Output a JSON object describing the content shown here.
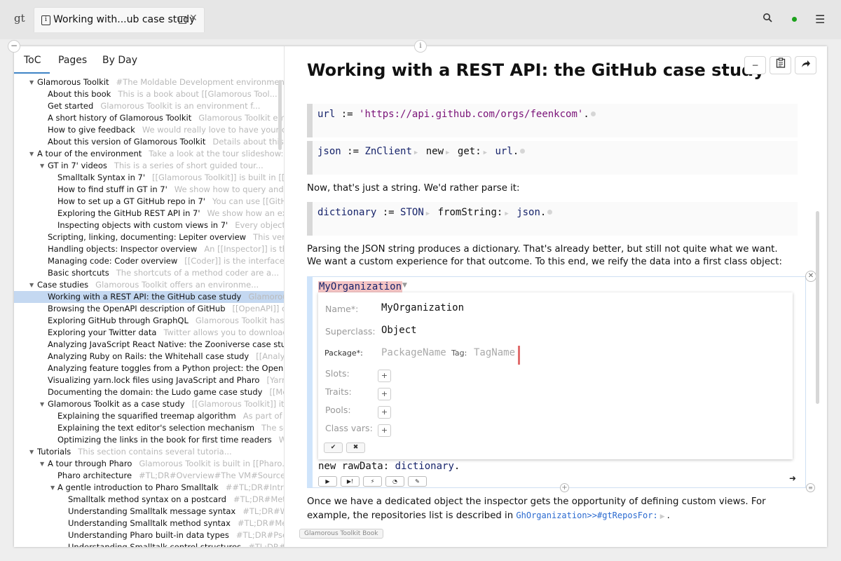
{
  "app": {
    "logo": "gt"
  },
  "tab": {
    "icon": "i",
    "label": "Working with...ub case study"
  },
  "left_tabs": [
    "ToC",
    "Pages",
    "By Day"
  ],
  "toc": [
    {
      "level": 1,
      "expanded": true,
      "title": "Glamorous Toolkit",
      "snippet": "#The Moldable Development environment..."
    },
    {
      "level": 2,
      "title": "About this book",
      "snippet": "This is a book about [[Glamorous Tool..."
    },
    {
      "level": 2,
      "title": "Get started",
      "snippet": "Glamorous Toolkit is an environment f..."
    },
    {
      "level": 2,
      "title": "A short history of Glamorous Toolkit",
      "snippet": "Glamorous Toolkit embodie"
    },
    {
      "level": 2,
      "title": "How to give feedback",
      "snippet": "We would really love to have your con..."
    },
    {
      "level": 2,
      "title": "About this version of Glamorous Toolkit",
      "snippet": "Details about this versio"
    },
    {
      "level": 1,
      "expanded": true,
      "title": "A tour of the environment",
      "snippet": "Take a look at the tour slideshow:GtP..."
    },
    {
      "level": 2,
      "expanded": true,
      "title": "GT in 7' videos",
      "snippet": "This is a series of short guided tour..."
    },
    {
      "level": 3,
      "title": "Smalltalk Syntax in 7'",
      "snippet": "[[Glamorous Toolkit]] is built in [[P..."
    },
    {
      "level": 3,
      "title": "How to find stuff in GT in 7'",
      "snippet": "We show how to query and explore"
    },
    {
      "level": 3,
      "title": "How to set up a GT GitHub repo in 7'",
      "snippet": "You can use [[GitHub]] to"
    },
    {
      "level": 3,
      "title": "Exploring the GitHub REST API in 7'",
      "snippet": "We show how an explorable"
    },
    {
      "level": 3,
      "title": "Inspecting objects with custom views in 7'",
      "snippet": "Every object in [[Glam"
    },
    {
      "level": 2,
      "title": "Scripting, linking, documenting: Lepiter overview",
      "snippet": "This very book i"
    },
    {
      "level": 2,
      "title": "Handling objects: Inspector overview",
      "snippet": "An [[Inspector]] is the most i"
    },
    {
      "level": 2,
      "title": "Managing code: Coder overview",
      "snippet": "[[Coder]] is the interface for mana"
    },
    {
      "level": 2,
      "title": "Basic shortcuts",
      "snippet": "The shortcuts of a method coder are a..."
    },
    {
      "level": 1,
      "expanded": true,
      "title": "Case studies",
      "snippet": "Glamorous Toolkit offers an environme..."
    },
    {
      "level": 2,
      "selected": true,
      "title": "Working with a REST API: the GitHub case study",
      "snippet": "Glamorous Toolk"
    },
    {
      "level": 2,
      "title": "Browsing the OpenAPI description of GitHub",
      "snippet": "[[OpenAPI]] offers a s"
    },
    {
      "level": 2,
      "title": "Exploring GitHub through GraphQL",
      "snippet": "Glamorous Toolkit has built-in"
    },
    {
      "level": 2,
      "title": "Exploring your Twitter data",
      "snippet": "Twitter allows you to download your"
    },
    {
      "level": 2,
      "title": "Analyzing JavaScript React Native: the Zooniverse case study",
      "snippet": "Zoo"
    },
    {
      "level": 2,
      "title": "Analyzing Ruby on Rails: the Whitehall case study",
      "snippet": "[[Analyzing Java"
    },
    {
      "level": 2,
      "title": "Analyzing feature toggles from a Python project: the Open edX case",
      "snippet": ""
    },
    {
      "level": 2,
      "title": "Visualizing yarn.lock files using JavaScript and Pharo",
      "snippet": "[Yarn](https"
    },
    {
      "level": 2,
      "title": "Documenting the domain: the Ludo game case study",
      "snippet": "[[Moldable D"
    },
    {
      "level": 2,
      "expanded": true,
      "title": "Glamorous Toolkit as a case study",
      "snippet": "[[Glamorous Toolkit]] itself is a"
    },
    {
      "level": 3,
      "title": "Explaining the squarified treemap algorithm",
      "snippet": "As part of the visu"
    },
    {
      "level": 3,
      "title": "Explaining the text editor's selection mechanism",
      "snippet": "The selection"
    },
    {
      "level": 3,
      "title": "Optimizing the links in the book for first time readers",
      "snippet": "Writing is"
    },
    {
      "level": 1,
      "expanded": true,
      "title": "Tutorials",
      "snippet": "This section contains several tutoria..."
    },
    {
      "level": 2,
      "expanded": true,
      "title": "A tour through Pharo",
      "snippet": "Glamorous Toolkit is built in [[Pharo..."
    },
    {
      "level": 3,
      "title": "Pharo architecture",
      "snippet": "#TL;DR#Overview#The VM#Sources#Chang"
    },
    {
      "level": 3,
      "expanded": true,
      "title": "A gentle introduction to Pharo Smalltalk",
      "snippet": "##TL;DR#Introduction"
    },
    {
      "level": 4,
      "title": "Smalltalk method syntax on a postcard",
      "snippet": "#TL;DR#Method syn"
    },
    {
      "level": 4,
      "title": "Understanding Smalltalk message syntax",
      "snippet": "#TL;DR#What is a"
    },
    {
      "level": 4,
      "title": "Understanding Smalltalk method syntax",
      "snippet": "#TL;DR#Methods#"
    },
    {
      "level": 4,
      "title": "Understanding Pharo built-in data types",
      "snippet": "#TL;DR#Pseudo va"
    },
    {
      "level": 4,
      "title": "Understanding Smalltalk control structures",
      "snippet": "#TL;DR#Overv"
    }
  ],
  "page": {
    "title": "Working with a REST API: the GitHub case study",
    "code1": {
      "var": "url",
      "assign": ":=",
      "value": "'https://api.github.com/orgs/feenkcom'",
      "end": "."
    },
    "code2": {
      "var": "json",
      "assign": ":=",
      "cls": "ZnClient",
      "msg1": "new",
      "msg2": "get:",
      "arg": "url",
      "end": "."
    },
    "para1": "Now, that's just a string. We'd rather parse it:",
    "code3": {
      "var": "dictionary",
      "assign": ":=",
      "cls": "STON",
      "msg": "fromString:",
      "arg": "json",
      "end": "."
    },
    "para2a": "Parsing the JSON string produces a dictionary. That's already better, but still not quite what we want.",
    "para2b": "We want a custom experience for that outcome. To this end, we reify the data into a first class object:",
    "editor": {
      "class_token": "MyOrganization",
      "form": {
        "name_label": "Name*:",
        "name_value": "MyOrganization",
        "super_label": "Superclass:",
        "super_value": "Object",
        "package_label": "Package*:",
        "package_placeholder": "PackageName",
        "tag_label": "Tag:",
        "tag_placeholder": "TagName",
        "slots_label": "Slots:",
        "traits_label": "Traits:",
        "pools_label": "Pools:",
        "classvars_label": "Class vars:",
        "plus": "+",
        "ok": "✔",
        "cancel": "✖"
      },
      "line": {
        "p1": "new rawData:",
        "p2": "dictionary",
        "p3": "."
      }
    },
    "para3a": "Once we have a dedicated object the inspector gets the opportunity of defining custom views. For",
    "para3b_text": "example, the repositories list is described in",
    "para3b_code": "GhOrganization>>#gtReposFor:",
    "para3b_end": "."
  },
  "footer": {
    "book_badge": "Glamorous Toolkit Book"
  },
  "colors": {
    "selection": "#c4d8f1",
    "accent": "#3f84c6",
    "status_dot": "#1ba11b",
    "error": "#e06d6d"
  }
}
